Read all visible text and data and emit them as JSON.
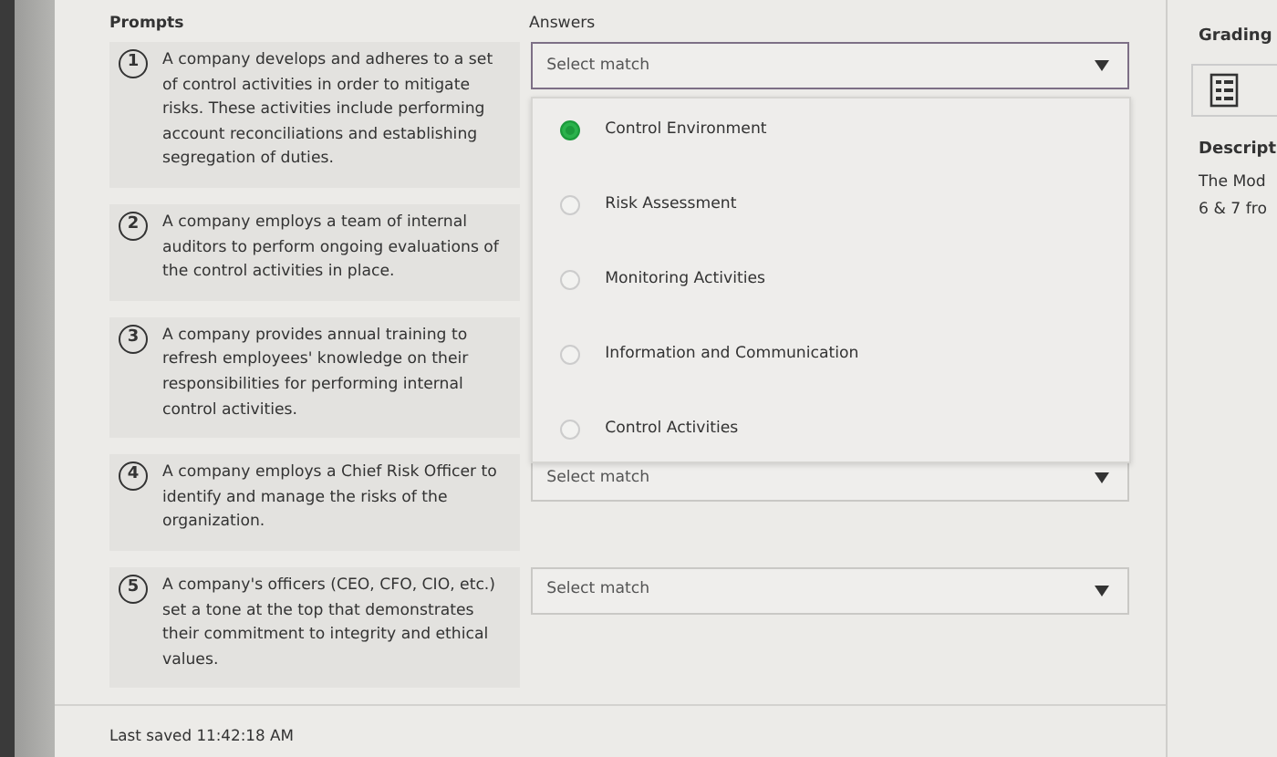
{
  "prompts_heading": "Prompts",
  "answers_heading": "Answers",
  "prompts": [
    {
      "number": "1",
      "text": "A company develops and adheres to a set of control activities in order to mitigate risks. These activities include performing account reconciliations and establishing segregation of duties.",
      "answer": {
        "placeholder": "Select match",
        "open": true,
        "options": [
          {
            "label": "Control Environment",
            "selected": true
          },
          {
            "label": "Risk Assessment",
            "selected": false
          },
          {
            "label": "Monitoring Activities",
            "selected": false
          },
          {
            "label": "Information and Communication",
            "selected": false
          },
          {
            "label": "Control Activities",
            "selected": false
          }
        ]
      }
    },
    {
      "number": "2",
      "text": "A company employs a team of internal auditors to perform ongoing evaluations of the control activities in place."
    },
    {
      "number": "3",
      "text": "A company provides annual training to refresh employees' knowledge on their responsibilities for performing internal control activities."
    },
    {
      "number": "4",
      "text": "A company employs a Chief Risk Officer to identify and manage the risks of the organization.",
      "answer": {
        "placeholder": "Select match",
        "open": false
      }
    },
    {
      "number": "5",
      "text": "A company's officers (CEO, CFO, CIO, etc.) set a tone at the top that demonstrates their commitment to integrity and ethical values.",
      "answer": {
        "placeholder": "Select match",
        "open": false
      }
    }
  ],
  "footer": {
    "last_saved": "Last saved 11:42:18 AM"
  },
  "side_panel": {
    "grading_heading": "Grading",
    "description_heading": "Descript",
    "description_lines": [
      "The Mod",
      "6 & 7 fro"
    ]
  }
}
